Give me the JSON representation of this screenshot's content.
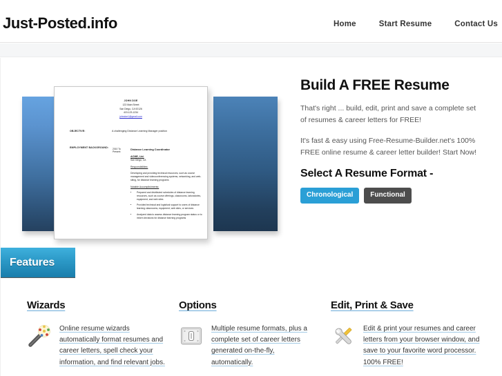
{
  "header": {
    "logo": "Just-Posted.info",
    "nav": [
      {
        "label": "Home",
        "name": "nav-home"
      },
      {
        "label": "Start Resume",
        "name": "nav-start-resume"
      },
      {
        "label": "Contact Us",
        "name": "nav-contact-us"
      }
    ]
  },
  "hero": {
    "heading": "Build A FREE Resume",
    "paragraph1": "That's right ... build, edit, print and save a complete set of resumes & career letters for FREE!",
    "paragraph2": "It's fast & easy using Free-Resume-Builder.net's 100% FREE online resume & career letter builder! Start Now!",
    "format_heading": "Select A Resume Format -",
    "buttons": [
      {
        "label": "Chronological",
        "style": "primary",
        "color": "#2a9fd6"
      },
      {
        "label": "Functional",
        "style": "default",
        "color": "#4d4d4d"
      }
    ]
  },
  "resume_preview": {
    "name": "JOHN DOE",
    "address": "123 Main Street",
    "city_state_zip": "San Diego, CA 92126",
    "phone": "419-123-1234",
    "email": "johndoe1@gmail.com",
    "objective_label": "OBJECTIVE:",
    "objective_value": "A challenging Distance Learning Manager position",
    "employment_label": "EMPLOYMENT BACKGROUND:",
    "dates": "2010 To Present",
    "job_title": "Distance Learning Coordinator",
    "company": "ACME, Ltd.",
    "company_location": "San Diego, CA",
    "responsibilities_heading": "Responsibilities:",
    "responsibilities_body": "Developing and providing technical resources, such as course management and videoconferencing systems, networking, and web-siting, for distance learning programs",
    "accomplishments_heading": "Notable Accomplishments:",
    "accomplishments": [
      "Prepared and distributed schedules of distance learning resources, such as course offerings, classrooms, laboratories, equipment, and web sites",
      "Provided technical and logistical support to users of distance learning classrooms, equipment, web sites, or services",
      "Analyzed data to assess distance learning program status or to inform decisions for distance learning programs"
    ]
  },
  "features_tab": {
    "label": "Features",
    "color": "#2d9bc9"
  },
  "feature_columns": [
    {
      "title": "Wizards",
      "icon": "magic-wand-icon",
      "text": "Online resume wizards automatically format resumes and career letters, spell check your information, and find relevant jobs."
    },
    {
      "title": "Options",
      "icon": "options-panel-icon",
      "text": "Multiple resume formats, plus a complete set of career letters generated on-the-fly, automatically."
    },
    {
      "title": "Edit, Print & Save",
      "icon": "tools-icon",
      "text": "Edit & print your resumes and career letters from your browser window, and save to your favorite word processor. 100% FREE!"
    }
  ]
}
